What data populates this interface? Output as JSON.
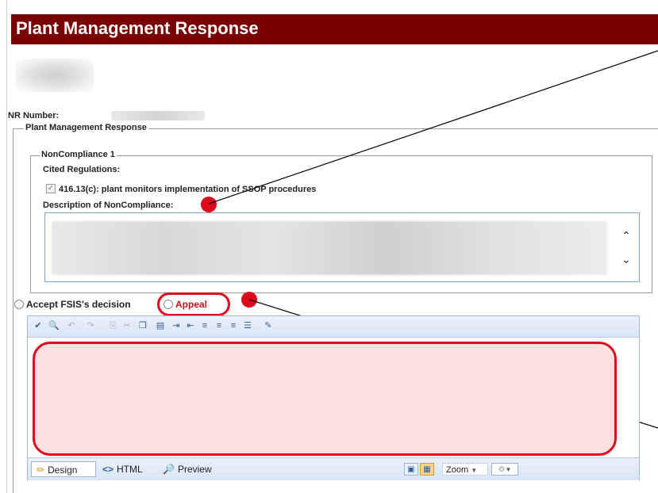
{
  "page": {
    "title": "Plant Management Response"
  },
  "header": {
    "nr_number_label": "NR Number:"
  },
  "response_group": {
    "legend": "Plant Management Response",
    "noncompliance": {
      "legend": "NonCompliance 1",
      "cited_label": "Cited Regulations:",
      "regulation": "416.13(c): plant monitors implementation of SSOP procedures",
      "regulation_checked": true,
      "description_label": "Description of NonCompliance:"
    },
    "options": {
      "accept_label": "Accept FSIS's decision",
      "appeal_label": "Appeal"
    }
  },
  "editor": {
    "toolbar_icons": [
      "spellcheck-icon",
      "find-icon",
      "undo-icon",
      "redo-icon",
      "copy-icon",
      "cut-icon",
      "paste-icon",
      "paste-text-icon",
      "indent-icon",
      "outdent-icon",
      "align-left-icon",
      "align-center-icon",
      "align-right-icon",
      "list-icon",
      "format-painter-icon"
    ],
    "modes": {
      "design": "Design",
      "html": "HTML",
      "preview": "Preview"
    },
    "zoom_label": "Zoom"
  },
  "colors": {
    "title_bar": "#7a0000",
    "annotation_red": "#e0081c",
    "highlight_fill": "#fde0e2"
  }
}
